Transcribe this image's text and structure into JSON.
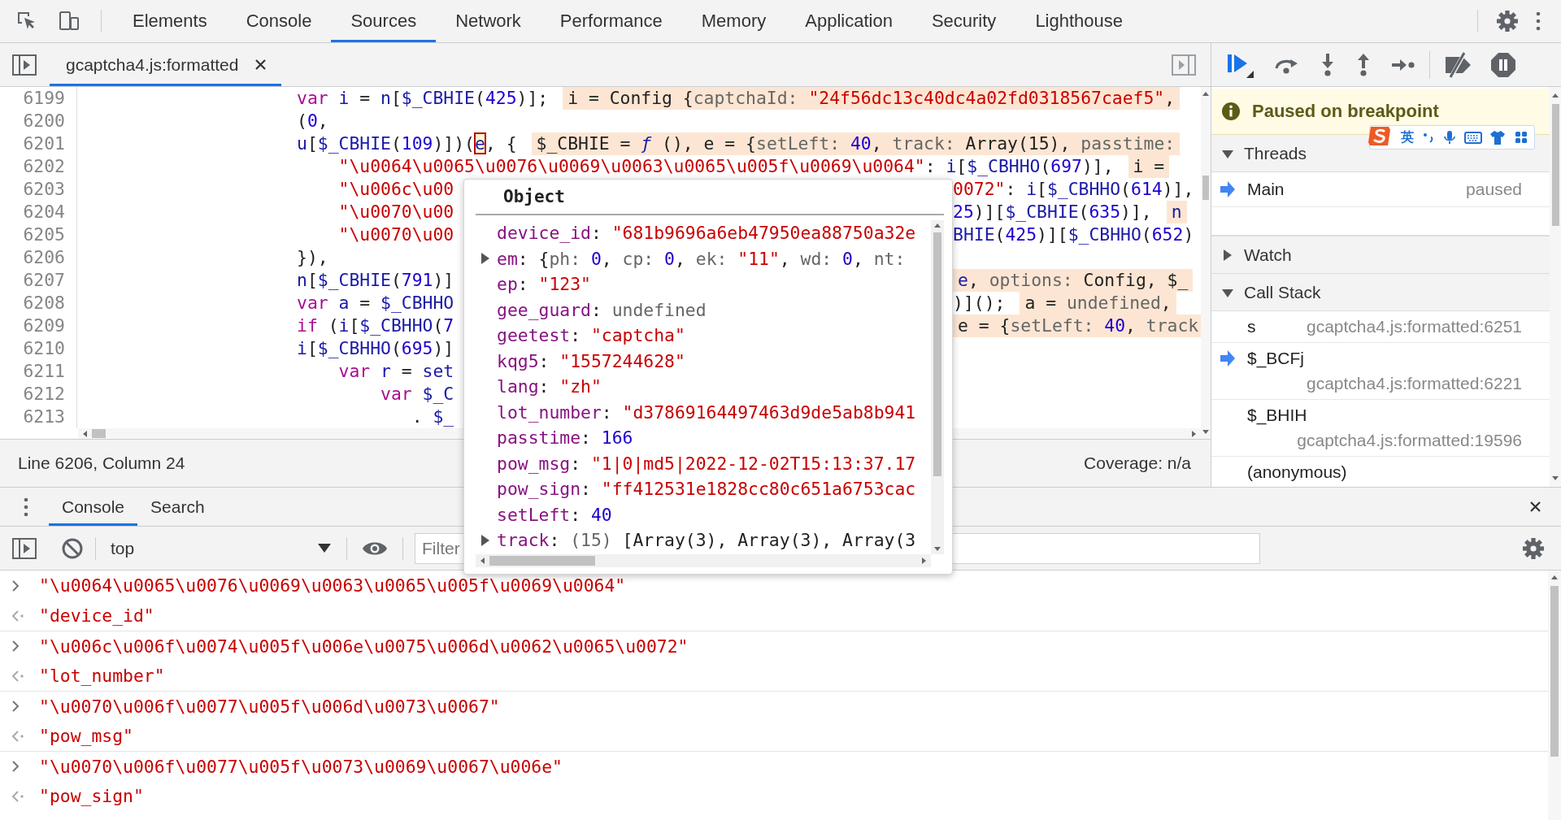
{
  "toolbar": {
    "tabs": [
      {
        "label": "Elements",
        "selected": false
      },
      {
        "label": "Console",
        "selected": false
      },
      {
        "label": "Sources",
        "selected": true
      },
      {
        "label": "Network",
        "selected": false
      },
      {
        "label": "Performance",
        "selected": false
      },
      {
        "label": "Memory",
        "selected": false
      },
      {
        "label": "Application",
        "selected": false
      },
      {
        "label": "Security",
        "selected": false
      },
      {
        "label": "Lighthouse",
        "selected": false
      }
    ]
  },
  "editor": {
    "file_tabs": [
      {
        "label": "gcaptcha4.js:formatted",
        "selected": true
      }
    ],
    "lines": [
      {
        "num": "6199",
        "code": [
          {
            "kind": "k",
            "text": "var "
          },
          {
            "kind": "v",
            "text": "i"
          },
          {
            "kind": "p",
            "text": " = "
          },
          {
            "kind": "v",
            "text": "n"
          },
          {
            "kind": "p",
            "text": "["
          },
          {
            "kind": "v",
            "text": "$_CBHIE"
          },
          {
            "kind": "p",
            "text": "("
          },
          {
            "kind": "n",
            "text": "425"
          },
          {
            "kind": "p",
            "text": ")];"
          }
        ],
        "hint": [
          {
            "kind": "p",
            "text": "i = Config {"
          },
          {
            "kind": "g",
            "text": "captchaId: "
          },
          {
            "kind": "s",
            "text": "\"24f56dc13c40dc4a02fd0318567caef5\""
          },
          {
            "kind": "p",
            "text": ","
          }
        ]
      },
      {
        "num": "6200",
        "code": [
          {
            "kind": "p",
            "text": "("
          },
          {
            "kind": "n",
            "text": "0"
          },
          {
            "kind": "p",
            "text": ","
          }
        ]
      },
      {
        "num": "6201",
        "code": [
          {
            "kind": "v",
            "text": "u"
          },
          {
            "kind": "p",
            "text": "["
          },
          {
            "kind": "v",
            "text": "$_CBHIE"
          },
          {
            "kind": "p",
            "text": "("
          },
          {
            "kind": "n",
            "text": "109"
          },
          {
            "kind": "p",
            "text": ")])("
          },
          {
            "kind": "c",
            "text": "e"
          },
          {
            "kind": "p",
            "text": ", {"
          }
        ],
        "hint": [
          {
            "kind": "p",
            "text": "$_CBHIE = "
          },
          {
            "kind": "f",
            "text": "ƒ"
          },
          {
            "kind": "p",
            "text": " (), e = {"
          },
          {
            "kind": "g",
            "text": "setLeft: "
          },
          {
            "kind": "n",
            "text": "40"
          },
          {
            "kind": "p",
            "text": ", "
          },
          {
            "kind": "g",
            "text": "track: "
          },
          {
            "kind": "p",
            "text": "Array(15), "
          },
          {
            "kind": "g",
            "text": "passtime:"
          }
        ]
      },
      {
        "num": "6202",
        "code": [
          {
            "kind": "s",
            "text": "    \"\\u0064\\u0065\\u0076\\u0069\\u0063\\u0065\\u005f\\u0069\\u0064\""
          },
          {
            "kind": "p",
            "text": ": "
          },
          {
            "kind": "v",
            "text": "i"
          },
          {
            "kind": "p",
            "text": "["
          },
          {
            "kind": "v",
            "text": "$_CBHHO"
          },
          {
            "kind": "p",
            "text": "("
          },
          {
            "kind": "n",
            "text": "697"
          },
          {
            "kind": "p",
            "text": ")],"
          }
        ],
        "hint": [
          {
            "kind": "p",
            "text": "i ="
          }
        ]
      },
      {
        "num": "6203",
        "code": [
          {
            "kind": "s",
            "text": "    \"\\u006c\\u00"
          }
        ],
        "right": {
          "code": [
            {
              "kind": "s",
              "text": "0072\""
            },
            {
              "kind": "p",
              "text": ": "
            },
            {
              "kind": "v",
              "text": "i"
            },
            {
              "kind": "p",
              "text": "["
            },
            {
              "kind": "v",
              "text": "$_CBHHO"
            },
            {
              "kind": "p",
              "text": "("
            },
            {
              "kind": "n",
              "text": "614"
            },
            {
              "kind": "p",
              "text": ")],"
            }
          ]
        }
      },
      {
        "num": "6204",
        "code": [
          {
            "kind": "s",
            "text": "    \"\\u0070\\u00"
          }
        ],
        "right": {
          "code": [
            {
              "kind": "n",
              "text": "25"
            },
            {
              "kind": "p",
              "text": ")]["
            },
            {
              "kind": "v",
              "text": "$_CBHIE"
            },
            {
              "kind": "p",
              "text": "("
            },
            {
              "kind": "n",
              "text": "635"
            },
            {
              "kind": "p",
              "text": ")],"
            }
          ],
          "hint": [
            {
              "kind": "v",
              "text": "n"
            }
          ]
        }
      },
      {
        "num": "6205",
        "code": [
          {
            "kind": "s",
            "text": "    \"\\u0070\\u00"
          }
        ],
        "right": {
          "code": [
            {
              "kind": "v",
              "text": "BHIE"
            },
            {
              "kind": "p",
              "text": "("
            },
            {
              "kind": "n",
              "text": "425"
            },
            {
              "kind": "p",
              "text": ")]["
            },
            {
              "kind": "v",
              "text": "$_CBHHO"
            },
            {
              "kind": "p",
              "text": "("
            },
            {
              "kind": "n",
              "text": "652"
            },
            {
              "kind": "p",
              "text": ")"
            }
          ]
        }
      },
      {
        "num": "6206",
        "code": [
          {
            "kind": "p",
            "text": "}),"
          }
        ]
      },
      {
        "num": "6207",
        "code": [
          {
            "kind": "v",
            "text": "n"
          },
          {
            "kind": "p",
            "text": "["
          },
          {
            "kind": "v",
            "text": "$_CBHIE"
          },
          {
            "kind": "p",
            "text": "("
          },
          {
            "kind": "n",
            "text": "791"
          },
          {
            "kind": "p",
            "text": ")]"
          }
        ],
        "right": {
          "hint": [
            {
              "kind": "v",
              "text": "e"
            },
            {
              "kind": "p",
              "text": ", "
            },
            {
              "kind": "g",
              "text": "options: "
            },
            {
              "kind": "p",
              "text": "Config, $_"
            }
          ]
        }
      },
      {
        "num": "6208",
        "code": [
          {
            "kind": "k",
            "text": "var "
          },
          {
            "kind": "v",
            "text": "a"
          },
          {
            "kind": "p",
            "text": " = "
          },
          {
            "kind": "v",
            "text": "$_CBHHO"
          }
        ],
        "right": {
          "code": [
            {
              "kind": "p",
              "text": ")]();"
            }
          ],
          "hint": [
            {
              "kind": "p",
              "text": "a = "
            },
            {
              "kind": "g",
              "text": "undefined"
            },
            {
              "kind": "p",
              "text": ","
            }
          ]
        }
      },
      {
        "num": "6209",
        "code": [
          {
            "kind": "k",
            "text": "if"
          },
          {
            "kind": "p",
            "text": " ("
          },
          {
            "kind": "v",
            "text": "i"
          },
          {
            "kind": "p",
            "text": "["
          },
          {
            "kind": "v",
            "text": "$_CBHHO"
          },
          {
            "kind": "p",
            "text": "("
          },
          {
            "kind": "n",
            "text": "7"
          }
        ],
        "right": {
          "hint": [
            {
              "kind": "p",
              "text": "e = {"
            },
            {
              "kind": "g",
              "text": "setLeft: "
            },
            {
              "kind": "n",
              "text": "40"
            },
            {
              "kind": "p",
              "text": ", "
            },
            {
              "kind": "g",
              "text": "track"
            }
          ]
        }
      },
      {
        "num": "6210",
        "code": [
          {
            "kind": "v",
            "text": "i"
          },
          {
            "kind": "p",
            "text": "["
          },
          {
            "kind": "v",
            "text": "$_CBHHO"
          },
          {
            "kind": "p",
            "text": "("
          },
          {
            "kind": "n",
            "text": "695"
          },
          {
            "kind": "p",
            "text": ")]"
          }
        ]
      },
      {
        "num": "6211",
        "code": [
          {
            "kind": "k",
            "text": "    var "
          },
          {
            "kind": "v",
            "text": "r"
          },
          {
            "kind": "p",
            "text": " = "
          },
          {
            "kind": "v",
            "text": "set"
          }
        ]
      },
      {
        "num": "6212",
        "code": [
          {
            "kind": "k",
            "text": "        var "
          },
          {
            "kind": "v",
            "text": "$_C"
          }
        ]
      },
      {
        "num": "6213",
        "code": [
          {
            "kind": "p",
            "text": "           . "
          },
          {
            "kind": "v",
            "text": "$_"
          }
        ]
      }
    ],
    "status": {
      "position": "Line 6206, Column 24",
      "coverage": "Coverage: n/a"
    }
  },
  "object_popup": {
    "title": "Object",
    "properties": [
      {
        "expandable": false,
        "text": [
          {
            "kind": "key",
            "text": "device_id"
          },
          {
            "kind": "p",
            "text": ": "
          },
          {
            "kind": "s",
            "text": "\"681b9696a6eb47950ea88750a32e"
          }
        ]
      },
      {
        "expandable": true,
        "text": [
          {
            "kind": "key",
            "text": "em"
          },
          {
            "kind": "p",
            "text": ": {"
          },
          {
            "kind": "g",
            "text": "ph: "
          },
          {
            "kind": "n",
            "text": "0"
          },
          {
            "kind": "p",
            "text": ", "
          },
          {
            "kind": "g",
            "text": "cp: "
          },
          {
            "kind": "n",
            "text": "0"
          },
          {
            "kind": "p",
            "text": ", "
          },
          {
            "kind": "g",
            "text": "ek: "
          },
          {
            "kind": "s",
            "text": "\"11\""
          },
          {
            "kind": "p",
            "text": ", "
          },
          {
            "kind": "g",
            "text": "wd: "
          },
          {
            "kind": "n",
            "text": "0"
          },
          {
            "kind": "p",
            "text": ", "
          },
          {
            "kind": "g",
            "text": "nt:"
          }
        ]
      },
      {
        "expandable": false,
        "text": [
          {
            "kind": "key",
            "text": "ep"
          },
          {
            "kind": "p",
            "text": ": "
          },
          {
            "kind": "s",
            "text": "\"123\""
          }
        ]
      },
      {
        "expandable": false,
        "text": [
          {
            "kind": "key",
            "text": "gee_guard"
          },
          {
            "kind": "p",
            "text": ": "
          },
          {
            "kind": "g",
            "text": "undefined"
          }
        ]
      },
      {
        "expandable": false,
        "text": [
          {
            "kind": "key",
            "text": "geetest"
          },
          {
            "kind": "p",
            "text": ": "
          },
          {
            "kind": "s",
            "text": "\"captcha\""
          }
        ]
      },
      {
        "expandable": false,
        "text": [
          {
            "kind": "key",
            "text": "kqg5"
          },
          {
            "kind": "p",
            "text": ": "
          },
          {
            "kind": "s",
            "text": "\"1557244628\""
          }
        ]
      },
      {
        "expandable": false,
        "text": [
          {
            "kind": "key",
            "text": "lang"
          },
          {
            "kind": "p",
            "text": ": "
          },
          {
            "kind": "s",
            "text": "\"zh\""
          }
        ]
      },
      {
        "expandable": false,
        "text": [
          {
            "kind": "key",
            "text": "lot_number"
          },
          {
            "kind": "p",
            "text": ": "
          },
          {
            "kind": "s",
            "text": "\"d37869164497463d9de5ab8b941"
          }
        ]
      },
      {
        "expandable": false,
        "text": [
          {
            "kind": "key",
            "text": "passtime"
          },
          {
            "kind": "p",
            "text": ": "
          },
          {
            "kind": "n",
            "text": "166"
          }
        ]
      },
      {
        "expandable": false,
        "text": [
          {
            "kind": "key",
            "text": "pow_msg"
          },
          {
            "kind": "p",
            "text": ": "
          },
          {
            "kind": "s",
            "text": "\"1|0|md5|2022-12-02T15:13:37.17"
          }
        ]
      },
      {
        "expandable": false,
        "text": [
          {
            "kind": "key",
            "text": "pow_sign"
          },
          {
            "kind": "p",
            "text": ": "
          },
          {
            "kind": "s",
            "text": "\"ff412531e1828cc80c651a6753cac"
          }
        ]
      },
      {
        "expandable": false,
        "text": [
          {
            "kind": "key",
            "text": "setLeft"
          },
          {
            "kind": "p",
            "text": ": "
          },
          {
            "kind": "n",
            "text": "40"
          }
        ]
      },
      {
        "expandable": true,
        "text": [
          {
            "kind": "key",
            "text": "track"
          },
          {
            "kind": "p",
            "text": ": "
          },
          {
            "kind": "g",
            "text": "(15) "
          },
          {
            "kind": "p",
            "text": "[Array(3), Array(3), Array(3"
          }
        ]
      }
    ]
  },
  "debugger": {
    "banner": "Paused on breakpoint",
    "ime_toolbar": {
      "mode": "英"
    },
    "threads": {
      "title": "Threads",
      "expanded": true,
      "items": [
        {
          "name": "Main",
          "status": "paused",
          "current": true
        }
      ]
    },
    "watch": {
      "title": "Watch",
      "expanded": false
    },
    "call_stack": {
      "title": "Call Stack",
      "expanded": true,
      "frames": [
        {
          "name": "s",
          "location": "gcaptcha4.js:formatted:6251",
          "current": false
        },
        {
          "name": "$_BCFj",
          "location": "gcaptcha4.js:formatted:6221",
          "current": true
        },
        {
          "name": "$_BHIH",
          "location": "gcaptcha4.js:formatted:19596",
          "current": false
        },
        {
          "name": "(anonymous)",
          "current": false
        }
      ]
    }
  },
  "drawer": {
    "tabs": [
      {
        "label": "Console",
        "selected": true
      },
      {
        "label": "Search",
        "selected": false
      }
    ],
    "context": "top",
    "filter": {
      "placeholder": "Filter"
    },
    "messages": [
      {
        "kind": "input",
        "text": "\"\\u0064\\u0065\\u0076\\u0069\\u0063\\u0065\\u005f\\u0069\\u0064\""
      },
      {
        "kind": "result",
        "text": "\"device_id\""
      },
      {
        "kind": "input",
        "text": "\"\\u006c\\u006f\\u0074\\u005f\\u006e\\u0075\\u006d\\u0062\\u0065\\u0072\""
      },
      {
        "kind": "result",
        "text": "\"lot_number\""
      },
      {
        "kind": "input",
        "text": "\"\\u0070\\u006f\\u0077\\u005f\\u006d\\u0073\\u0067\""
      },
      {
        "kind": "result",
        "text": "\"pow_msg\""
      },
      {
        "kind": "input",
        "text": "\"\\u0070\\u006f\\u0077\\u005f\\u0073\\u0069\\u0067\\u006e\""
      },
      {
        "kind": "result",
        "text": "\"pow_sign\""
      }
    ]
  }
}
